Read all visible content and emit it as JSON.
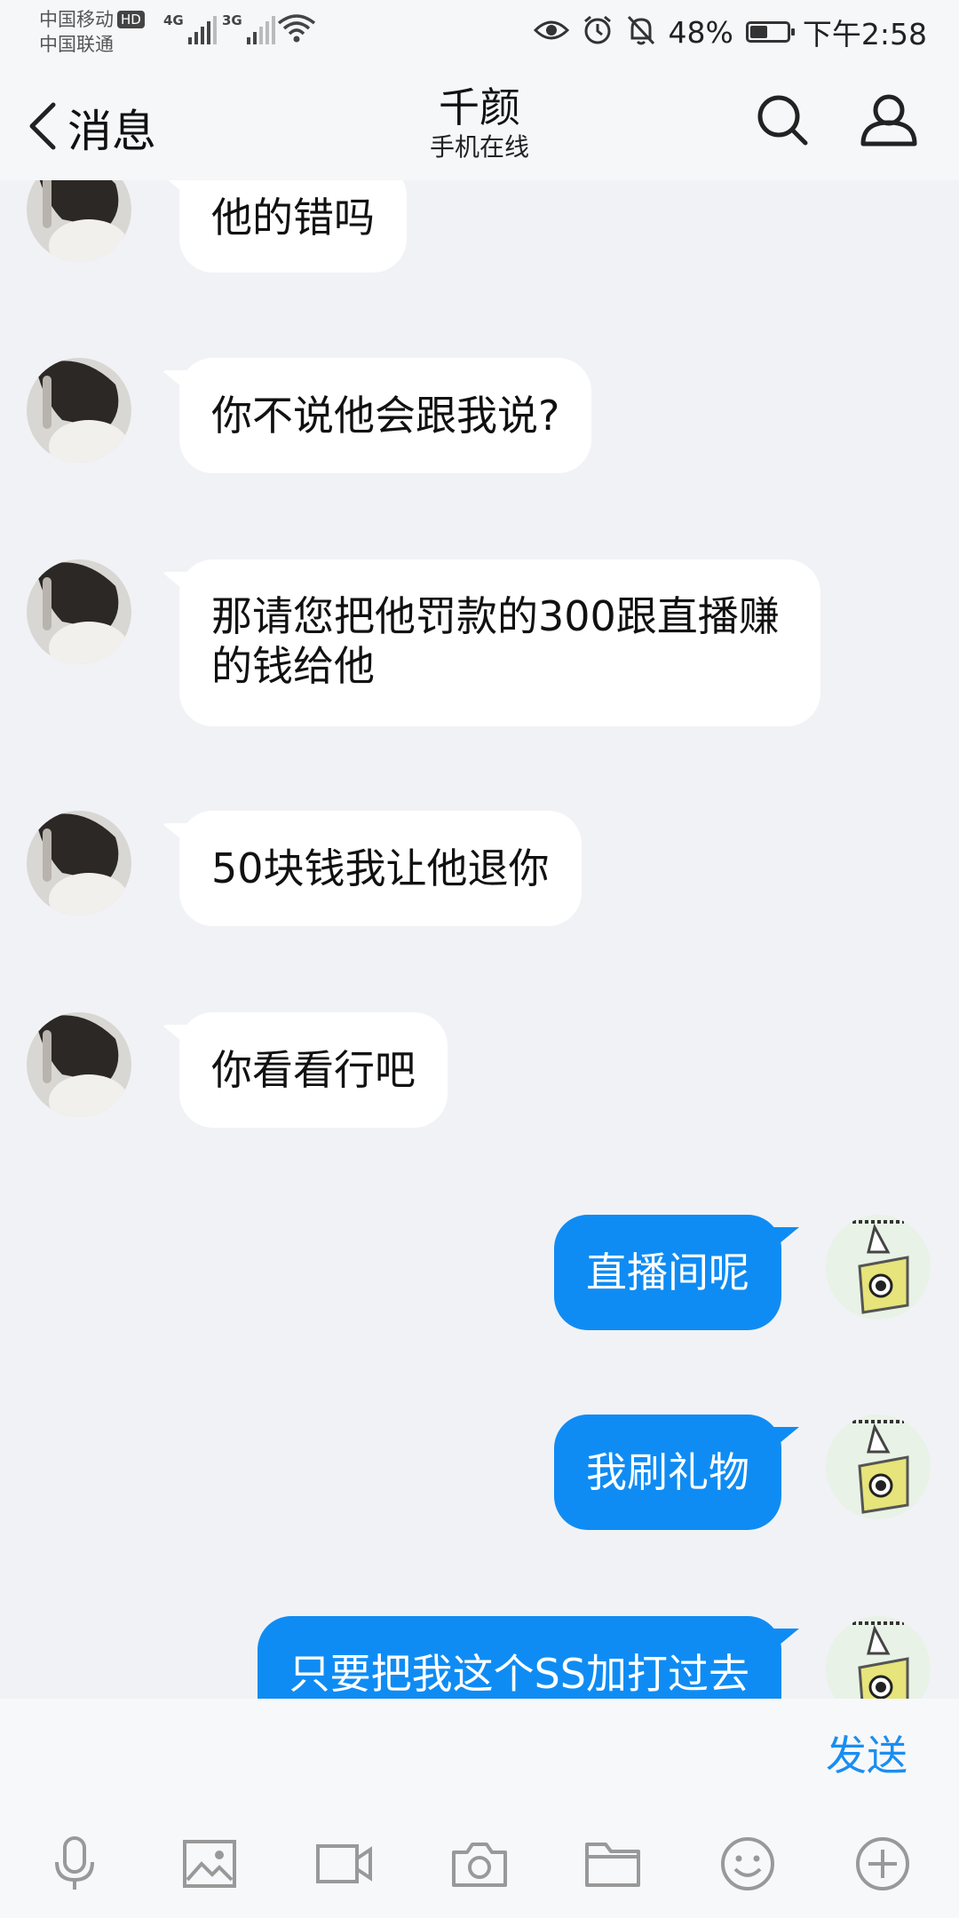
{
  "status_bar": {
    "carrier_1": "中国移动",
    "carrier_2": "中国联通",
    "hd": "HD",
    "net_1": "4G",
    "net_2": "3G",
    "battery_percent": "48%",
    "battery_level": 0.48,
    "time": "下午2:58",
    "icons": [
      "eye-icon",
      "alarm-icon",
      "bell-off-icon",
      "battery-icon",
      "wifi-icon",
      "signal-icon"
    ]
  },
  "header": {
    "back_label": "消息",
    "title": "千颜",
    "subtitle": "手机在线",
    "icons": [
      "back-chevron-icon",
      "search-icon",
      "profile-icon"
    ]
  },
  "messages": [
    {
      "side": "in",
      "text": "他的错吗"
    },
    {
      "side": "in",
      "text": "你不说他会跟我说?"
    },
    {
      "side": "in",
      "text": "那请您把他罚款的300跟直播赚的钱给他"
    },
    {
      "side": "in",
      "text": "50块钱我让他退你"
    },
    {
      "side": "in",
      "text": "你看看行吧"
    },
    {
      "side": "out",
      "text": "直播间呢"
    },
    {
      "side": "out",
      "text": "我刷礼物"
    },
    {
      "side": "out",
      "text": "只要把我这个SS加打过去"
    }
  ],
  "input": {
    "send_label": "发送"
  },
  "toolbar": {
    "icons": [
      "microphone-icon",
      "image-icon",
      "video-icon",
      "camera-icon",
      "folder-icon",
      "emoji-icon",
      "plus-icon"
    ]
  },
  "colors": {
    "background": "#f1f2f6",
    "outgoing_bubble": "#0f8cf3",
    "incoming_bubble": "#ffffff",
    "accent": "#1a8ef0"
  }
}
